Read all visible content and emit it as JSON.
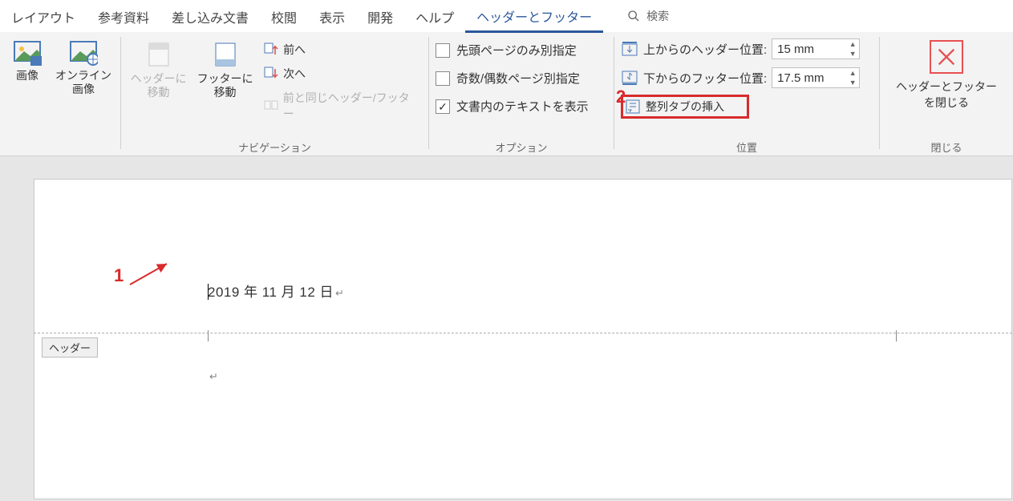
{
  "tabs": [
    "レイアウト",
    "参考資料",
    "差し込み文書",
    "校閲",
    "表示",
    "開発",
    "ヘルプ",
    "ヘッダーとフッター"
  ],
  "active_tab_index": 7,
  "search_placeholder": "検索",
  "ribbon": {
    "images": {
      "picture": "画像",
      "online_picture": "オンライン\n画像"
    },
    "navigation": {
      "goto_header": "ヘッダーに\n移動",
      "goto_footer": "フッターに\n移動",
      "previous": "前へ",
      "next": "次へ",
      "link_prev": "前と同じヘッダー/フッター",
      "group_label": "ナビゲーション"
    },
    "options": {
      "first_page": "先頭ページのみ別指定",
      "odd_even": "奇数/偶数ページ別指定",
      "show_text": "文書内のテキストを表示",
      "show_text_checked": true,
      "group_label": "オプション"
    },
    "position": {
      "header_from_top": "上からのヘッダー位置:",
      "footer_from_bottom": "下からのフッター位置:",
      "header_value": "15 mm",
      "footer_value": "17.5 mm",
      "insert_align_tab": "整列タブの挿入",
      "group_label": "位置"
    },
    "close": {
      "label": "ヘッダーとフッター\nを閉じる",
      "group_label": "閉じる"
    }
  },
  "document": {
    "header_text": "2019 年 11 月 12 日",
    "header_tag": "ヘッダー"
  },
  "annotations": {
    "n1": "1",
    "n2": "2"
  }
}
